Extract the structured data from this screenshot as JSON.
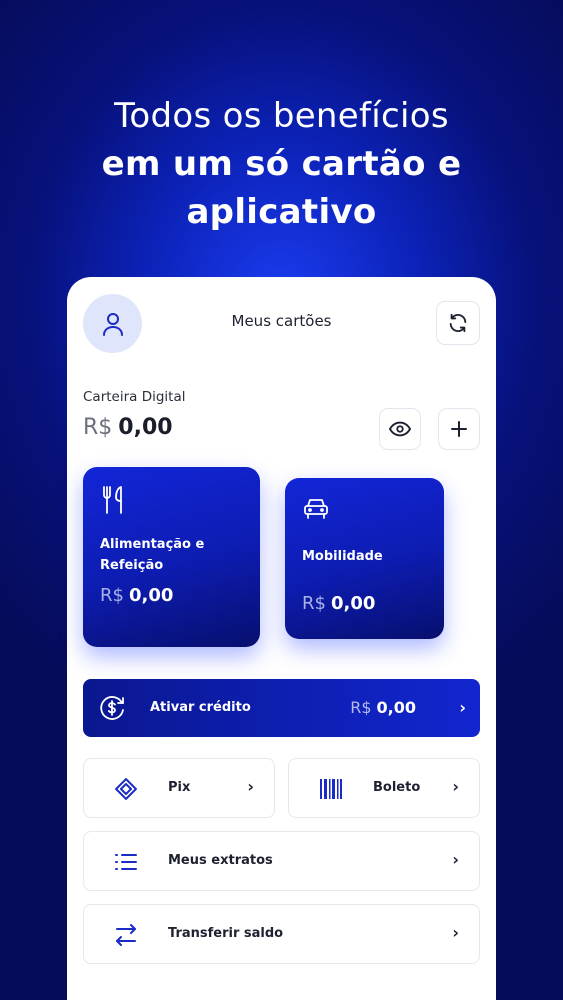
{
  "headline": {
    "line1": "Todos os benefícios",
    "line2": "em um só cartão e",
    "line3": "aplicativo"
  },
  "header": {
    "title": "Meus cartões",
    "avatar_icon": "user-icon",
    "refresh_icon": "refresh-icon"
  },
  "wallet": {
    "label": "Carteira Digital",
    "currency": "R$",
    "amount": "0,00",
    "eye_icon": "eye-icon",
    "add_icon": "plus-icon"
  },
  "cards": [
    {
      "name": "Alimentação e Refeição",
      "currency": "R$",
      "amount": "0,00",
      "icon": "fork-knife-icon"
    },
    {
      "name": "Mobilidade",
      "currency": "R$",
      "amount": "0,00",
      "icon": "car-icon"
    }
  ],
  "activate": {
    "label": "Ativar crédito",
    "currency": "R$",
    "amount": "0,00",
    "icon": "dollar-circle-icon",
    "chevron": "›"
  },
  "actions": [
    {
      "label": "Pix",
      "icon": "pix-icon",
      "chevron": "›"
    },
    {
      "label": "Boleto",
      "icon": "barcode-icon",
      "chevron": "›"
    },
    {
      "label": "Meus extratos",
      "icon": "list-icon",
      "chevron": "›"
    },
    {
      "label": "Transferir saldo",
      "icon": "transfer-icon",
      "chevron": "›"
    }
  ],
  "colors": {
    "brand_blue": "#1226d0",
    "background_dark": "#060c5a",
    "icon_blue": "#1a2bc8"
  }
}
